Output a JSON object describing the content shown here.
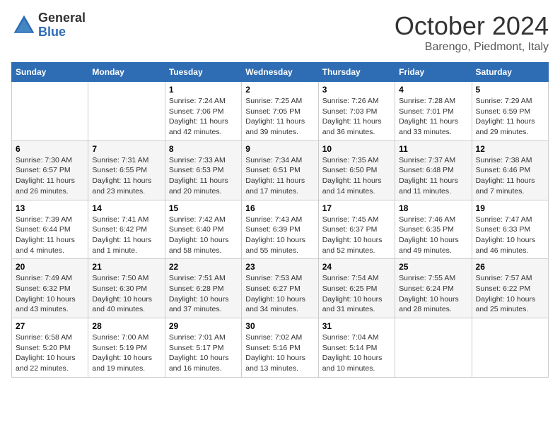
{
  "header": {
    "logo_general": "General",
    "logo_blue": "Blue",
    "month_title": "October 2024",
    "location": "Barengo, Piedmont, Italy"
  },
  "weekdays": [
    "Sunday",
    "Monday",
    "Tuesday",
    "Wednesday",
    "Thursday",
    "Friday",
    "Saturday"
  ],
  "weeks": [
    [
      {
        "day": "",
        "sunrise": "",
        "sunset": "",
        "daylight": ""
      },
      {
        "day": "",
        "sunrise": "",
        "sunset": "",
        "daylight": ""
      },
      {
        "day": "1",
        "sunrise": "Sunrise: 7:24 AM",
        "sunset": "Sunset: 7:06 PM",
        "daylight": "Daylight: 11 hours and 42 minutes."
      },
      {
        "day": "2",
        "sunrise": "Sunrise: 7:25 AM",
        "sunset": "Sunset: 7:05 PM",
        "daylight": "Daylight: 11 hours and 39 minutes."
      },
      {
        "day": "3",
        "sunrise": "Sunrise: 7:26 AM",
        "sunset": "Sunset: 7:03 PM",
        "daylight": "Daylight: 11 hours and 36 minutes."
      },
      {
        "day": "4",
        "sunrise": "Sunrise: 7:28 AM",
        "sunset": "Sunset: 7:01 PM",
        "daylight": "Daylight: 11 hours and 33 minutes."
      },
      {
        "day": "5",
        "sunrise": "Sunrise: 7:29 AM",
        "sunset": "Sunset: 6:59 PM",
        "daylight": "Daylight: 11 hours and 29 minutes."
      }
    ],
    [
      {
        "day": "6",
        "sunrise": "Sunrise: 7:30 AM",
        "sunset": "Sunset: 6:57 PM",
        "daylight": "Daylight: 11 hours and 26 minutes."
      },
      {
        "day": "7",
        "sunrise": "Sunrise: 7:31 AM",
        "sunset": "Sunset: 6:55 PM",
        "daylight": "Daylight: 11 hours and 23 minutes."
      },
      {
        "day": "8",
        "sunrise": "Sunrise: 7:33 AM",
        "sunset": "Sunset: 6:53 PM",
        "daylight": "Daylight: 11 hours and 20 minutes."
      },
      {
        "day": "9",
        "sunrise": "Sunrise: 7:34 AM",
        "sunset": "Sunset: 6:51 PM",
        "daylight": "Daylight: 11 hours and 17 minutes."
      },
      {
        "day": "10",
        "sunrise": "Sunrise: 7:35 AM",
        "sunset": "Sunset: 6:50 PM",
        "daylight": "Daylight: 11 hours and 14 minutes."
      },
      {
        "day": "11",
        "sunrise": "Sunrise: 7:37 AM",
        "sunset": "Sunset: 6:48 PM",
        "daylight": "Daylight: 11 hours and 11 minutes."
      },
      {
        "day": "12",
        "sunrise": "Sunrise: 7:38 AM",
        "sunset": "Sunset: 6:46 PM",
        "daylight": "Daylight: 11 hours and 7 minutes."
      }
    ],
    [
      {
        "day": "13",
        "sunrise": "Sunrise: 7:39 AM",
        "sunset": "Sunset: 6:44 PM",
        "daylight": "Daylight: 11 hours and 4 minutes."
      },
      {
        "day": "14",
        "sunrise": "Sunrise: 7:41 AM",
        "sunset": "Sunset: 6:42 PM",
        "daylight": "Daylight: 11 hours and 1 minute."
      },
      {
        "day": "15",
        "sunrise": "Sunrise: 7:42 AM",
        "sunset": "Sunset: 6:40 PM",
        "daylight": "Daylight: 10 hours and 58 minutes."
      },
      {
        "day": "16",
        "sunrise": "Sunrise: 7:43 AM",
        "sunset": "Sunset: 6:39 PM",
        "daylight": "Daylight: 10 hours and 55 minutes."
      },
      {
        "day": "17",
        "sunrise": "Sunrise: 7:45 AM",
        "sunset": "Sunset: 6:37 PM",
        "daylight": "Daylight: 10 hours and 52 minutes."
      },
      {
        "day": "18",
        "sunrise": "Sunrise: 7:46 AM",
        "sunset": "Sunset: 6:35 PM",
        "daylight": "Daylight: 10 hours and 49 minutes."
      },
      {
        "day": "19",
        "sunrise": "Sunrise: 7:47 AM",
        "sunset": "Sunset: 6:33 PM",
        "daylight": "Daylight: 10 hours and 46 minutes."
      }
    ],
    [
      {
        "day": "20",
        "sunrise": "Sunrise: 7:49 AM",
        "sunset": "Sunset: 6:32 PM",
        "daylight": "Daylight: 10 hours and 43 minutes."
      },
      {
        "day": "21",
        "sunrise": "Sunrise: 7:50 AM",
        "sunset": "Sunset: 6:30 PM",
        "daylight": "Daylight: 10 hours and 40 minutes."
      },
      {
        "day": "22",
        "sunrise": "Sunrise: 7:51 AM",
        "sunset": "Sunset: 6:28 PM",
        "daylight": "Daylight: 10 hours and 37 minutes."
      },
      {
        "day": "23",
        "sunrise": "Sunrise: 7:53 AM",
        "sunset": "Sunset: 6:27 PM",
        "daylight": "Daylight: 10 hours and 34 minutes."
      },
      {
        "day": "24",
        "sunrise": "Sunrise: 7:54 AM",
        "sunset": "Sunset: 6:25 PM",
        "daylight": "Daylight: 10 hours and 31 minutes."
      },
      {
        "day": "25",
        "sunrise": "Sunrise: 7:55 AM",
        "sunset": "Sunset: 6:24 PM",
        "daylight": "Daylight: 10 hours and 28 minutes."
      },
      {
        "day": "26",
        "sunrise": "Sunrise: 7:57 AM",
        "sunset": "Sunset: 6:22 PM",
        "daylight": "Daylight: 10 hours and 25 minutes."
      }
    ],
    [
      {
        "day": "27",
        "sunrise": "Sunrise: 6:58 AM",
        "sunset": "Sunset: 5:20 PM",
        "daylight": "Daylight: 10 hours and 22 minutes."
      },
      {
        "day": "28",
        "sunrise": "Sunrise: 7:00 AM",
        "sunset": "Sunset: 5:19 PM",
        "daylight": "Daylight: 10 hours and 19 minutes."
      },
      {
        "day": "29",
        "sunrise": "Sunrise: 7:01 AM",
        "sunset": "Sunset: 5:17 PM",
        "daylight": "Daylight: 10 hours and 16 minutes."
      },
      {
        "day": "30",
        "sunrise": "Sunrise: 7:02 AM",
        "sunset": "Sunset: 5:16 PM",
        "daylight": "Daylight: 10 hours and 13 minutes."
      },
      {
        "day": "31",
        "sunrise": "Sunrise: 7:04 AM",
        "sunset": "Sunset: 5:14 PM",
        "daylight": "Daylight: 10 hours and 10 minutes."
      },
      {
        "day": "",
        "sunrise": "",
        "sunset": "",
        "daylight": ""
      },
      {
        "day": "",
        "sunrise": "",
        "sunset": "",
        "daylight": ""
      }
    ]
  ]
}
